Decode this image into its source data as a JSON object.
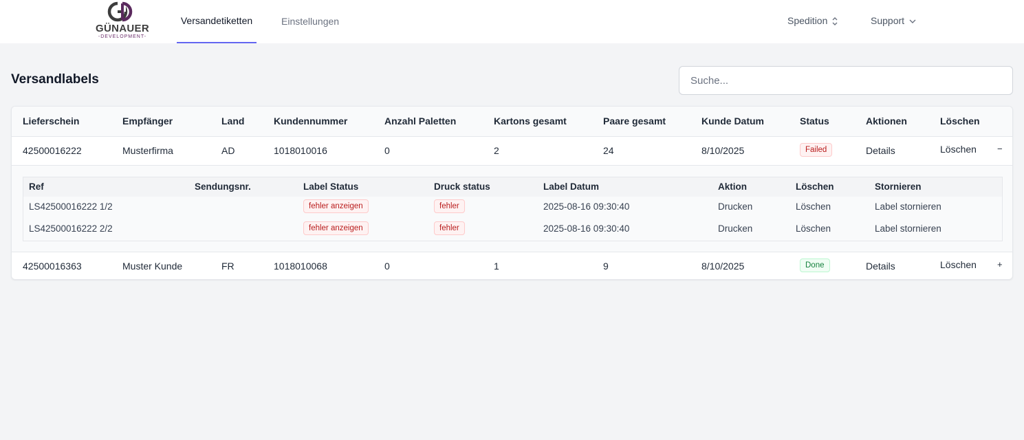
{
  "header": {
    "logo_word": "GÜNAUER",
    "logo_sub": "-DEVELOPMENT-",
    "tabs": [
      {
        "label": "Versandetiketten",
        "active": true
      },
      {
        "label": "Einstellungen",
        "active": false
      }
    ],
    "menus": [
      {
        "label": "Spedition",
        "icon": "chevron-up-down-icon"
      },
      {
        "label": "Support",
        "icon": "chevron-down-icon"
      }
    ]
  },
  "page": {
    "title": "Versandlabels",
    "search_placeholder": "Suche..."
  },
  "table": {
    "columns": [
      "Lieferschein",
      "Empfänger",
      "Land",
      "Kundennummer",
      "Anzahl Paletten",
      "Kartons gesamt",
      "Paare gesamt",
      "Kunde Datum",
      "Status",
      "Aktionen",
      "Löschen"
    ],
    "rows": [
      {
        "lieferschein": "42500016222",
        "empfaenger": "Musterfirma",
        "land": "AD",
        "kundennummer": "1018010016",
        "paletten": "0",
        "kartons": "2",
        "paare": "24",
        "datum": "8/10/2025",
        "status": "Failed",
        "aktion": "Details",
        "loeschen": "Löschen",
        "toggle": "−",
        "expanded": true
      },
      {
        "lieferschein": "42500016363",
        "empfaenger": "Muster Kunde",
        "land": "FR",
        "kundennummer": "1018010068",
        "paletten": "0",
        "kartons": "1",
        "paare": "9",
        "datum": "8/10/2025",
        "status": "Done",
        "aktion": "Details",
        "loeschen": "Löschen",
        "toggle": "+",
        "expanded": false
      }
    ]
  },
  "subtable": {
    "columns": [
      "Ref",
      "Sendungsnr.",
      "Label Status",
      "Druck status",
      "Label Datum",
      "Aktion",
      "Löschen",
      "Stornieren"
    ],
    "rows": [
      {
        "ref": "LS42500016222 1/2",
        "sendungsnr": "",
        "label_status": "fehler anzeigen",
        "druck_status": "fehler",
        "label_datum": "2025-08-16 09:30:40",
        "aktion": "Drucken",
        "loeschen": "Löschen",
        "stornieren": "Label stornieren"
      },
      {
        "ref": "LS42500016222 2/2",
        "sendungsnr": "",
        "label_status": "fehler anzeigen",
        "druck_status": "fehler",
        "label_datum": "2025-08-16 09:30:40",
        "aktion": "Drucken",
        "loeschen": "Löschen",
        "stornieren": "Label stornieren"
      }
    ]
  },
  "colors": {
    "accent": "#6366f1",
    "danger": "#dc2626",
    "success": "#15803d",
    "link": "#4f46e5"
  }
}
